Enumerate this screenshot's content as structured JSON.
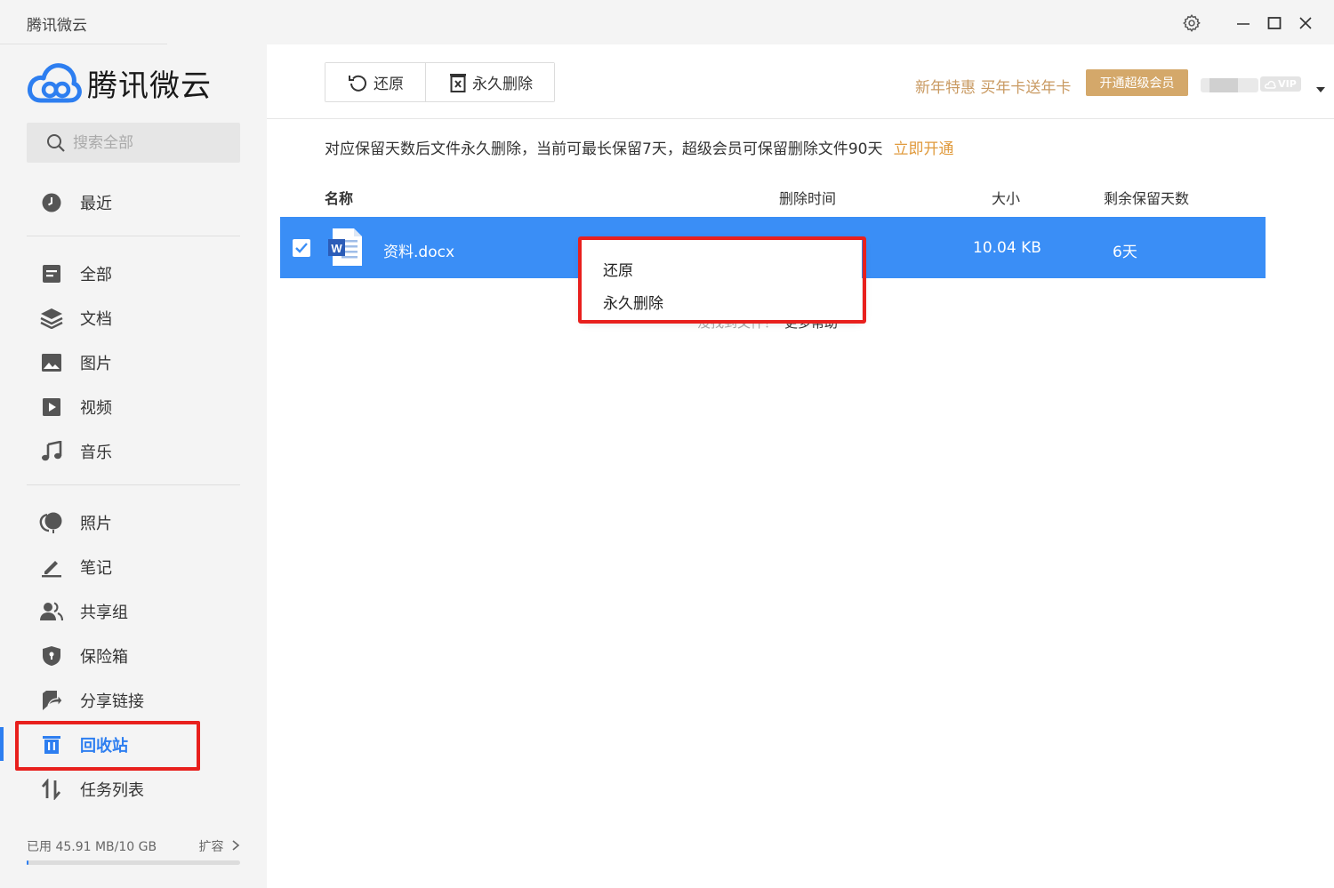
{
  "window": {
    "title": "腾讯微云",
    "controls": [
      "settings",
      "minimize",
      "maximize",
      "close"
    ]
  },
  "sidebar": {
    "logo_text": "腾讯微云",
    "search": {
      "placeholder": "搜索全部"
    },
    "items": [
      {
        "id": "recent",
        "label": "最近",
        "icon": "clock-icon"
      },
      {
        "id": "all",
        "label": "全部",
        "icon": "file-list-icon"
      },
      {
        "id": "docs",
        "label": "文档",
        "icon": "layers-icon"
      },
      {
        "id": "images",
        "label": "图片",
        "icon": "image-icon"
      },
      {
        "id": "video",
        "label": "视频",
        "icon": "play-icon"
      },
      {
        "id": "music",
        "label": "音乐",
        "icon": "music-note-icon"
      },
      {
        "id": "photos",
        "label": "照片",
        "icon": "photo-balloon-icon"
      },
      {
        "id": "notes",
        "label": "笔记",
        "icon": "pen-icon"
      },
      {
        "id": "share-group",
        "label": "共享组",
        "icon": "users-icon"
      },
      {
        "id": "safe",
        "label": "保险箱",
        "icon": "shield-icon"
      },
      {
        "id": "share-link",
        "label": "分享链接",
        "icon": "share-arrow-icon"
      },
      {
        "id": "recycle",
        "label": "回收站",
        "icon": "trash-icon",
        "active": true
      },
      {
        "id": "tasks",
        "label": "任务列表",
        "icon": "transfer-icon"
      }
    ],
    "storage": {
      "used_text": "已用 45.91 MB/10 GB",
      "expand_label": "扩容",
      "used_fraction": 0.0045
    }
  },
  "toolbar": {
    "restore_label": "还原",
    "delete_label": "永久删除"
  },
  "header": {
    "promo_text": "新年特惠 买年卡送年卡",
    "vip_button": "开通超级会员",
    "vip_badge": "VIP"
  },
  "notice": {
    "text": "对应保留天数后文件永久删除，当前可最长保留7天，超级会员可保留删除文件90天",
    "link": "立即开通"
  },
  "table": {
    "columns": {
      "name": "名称",
      "deleted_time": "删除时间",
      "size": "大小",
      "days_left": "剩余保留天数"
    },
    "rows": [
      {
        "name": "资料.docx",
        "deleted_time": "",
        "size": "10.04 KB",
        "days_left": "6天",
        "selected": true
      }
    ]
  },
  "empty_help": {
    "text": "没找到文件？",
    "more": "更多帮助"
  },
  "context_menu": {
    "items": [
      "还原",
      "永久删除"
    ]
  },
  "colors": {
    "accent": "#2d7ef0",
    "row_selected": "#3a8ef6",
    "highlight": "#e8201d",
    "promo": "#c99a62",
    "vip_button": "#d4a86a"
  }
}
